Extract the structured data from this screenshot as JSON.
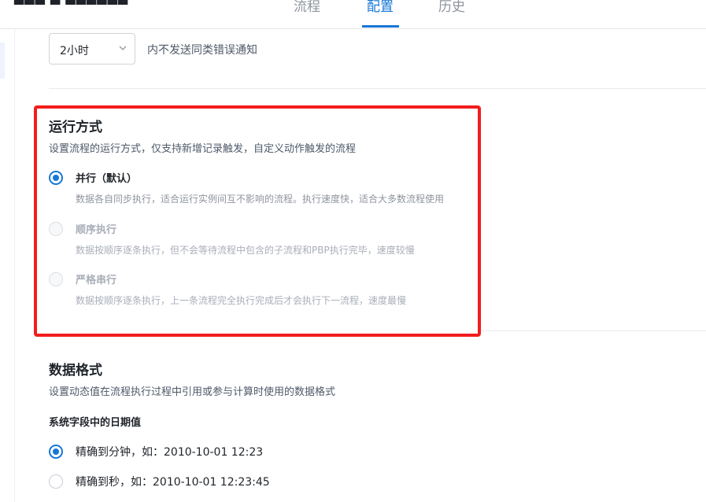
{
  "header": {
    "tabs": [
      {
        "label": "流程",
        "active": false
      },
      {
        "label": "配置",
        "active": true
      },
      {
        "label": "历史",
        "active": false
      }
    ]
  },
  "notification": {
    "select_value": "2小时",
    "suffix_text": "内不发送同类错误通知"
  },
  "run_mode": {
    "title": "运行方式",
    "description": "设置流程的运行方式，仅支持新增记录触发，自定义动作触发的流程",
    "options": [
      {
        "label": "并行（默认）",
        "description": "数据各自同步执行，适合运行实例间互不影响的流程。执行速度快，适合大多数流程使用",
        "selected": true,
        "disabled": false
      },
      {
        "label": "顺序执行",
        "description": "数据按顺序逐条执行，但不会等待流程中包含的子流程和PBP执行完毕，速度较慢",
        "selected": false,
        "disabled": true
      },
      {
        "label": "严格串行",
        "description": "数据按顺序逐条执行，上一条流程完全执行完成后才会执行下一流程，速度最慢",
        "selected": false,
        "disabled": true
      }
    ]
  },
  "data_format": {
    "title": "数据格式",
    "description": "设置动态值在流程执行过程中引用或参与计算时使用的数据格式",
    "subtitle": "系统字段中的日期值",
    "options": [
      {
        "label": "精确到分钟，如：2010-10-01 12:23",
        "selected": true
      },
      {
        "label": "精确到秒，如：2010-10-01 12:23:45",
        "selected": false
      }
    ]
  },
  "colors": {
    "accent": "#1677d6",
    "highlight_box": "#f21d1d"
  }
}
